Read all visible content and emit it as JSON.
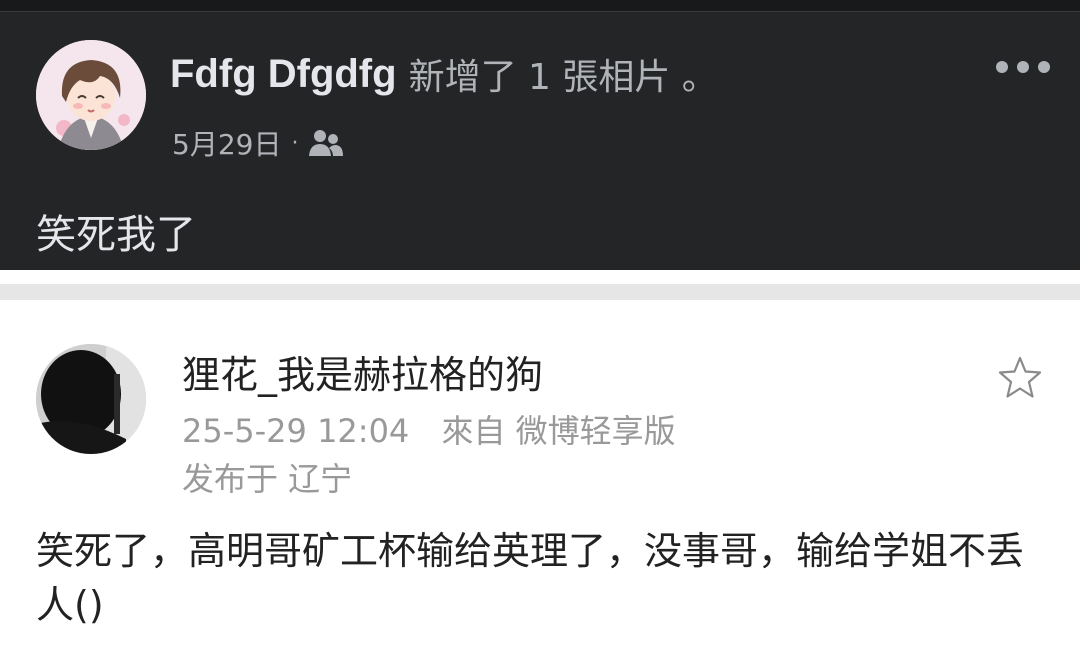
{
  "facebook_post": {
    "author": "Fdfg Dfgdfg",
    "action": "新增了 1 張相片 。",
    "date": "5月29日",
    "separator": "·",
    "audience_icon": "friends-icon",
    "more_icon": "more-horizontal-icon",
    "text": "笑死我了",
    "colors": {
      "background": "#242526",
      "text": "#e4e6eb",
      "secondary": "#b0b3b8"
    }
  },
  "weibo_post": {
    "username": "狸花_我是赫拉格的狗",
    "time": "25-5-29 12:04",
    "source": "來自 微博轻享版",
    "location": "发布于 辽宁",
    "favorite_icon": "star-icon",
    "text": "笑死了，高明哥矿工杯输给英理了，没事哥，输给学姐不丢人()",
    "colors": {
      "text": "#222222",
      "meta": "#999999"
    }
  }
}
